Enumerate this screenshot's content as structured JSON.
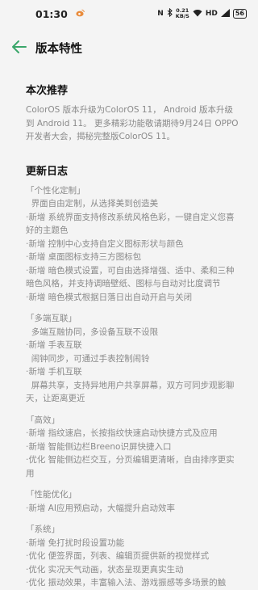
{
  "status_bar": {
    "time": "01:30",
    "app_icon": "weibo-icon",
    "nfc": "N",
    "bluetooth_icon": "bluetooth-icon",
    "net_speed": "0.21",
    "net_unit": "KB/S",
    "signal_label": "HD",
    "battery": "56"
  },
  "header": {
    "back_icon": "back-arrow-icon",
    "title": "版本特性",
    "accent_color": "#3aa66a"
  },
  "recommend": {
    "title": "本次推荐",
    "text": "ColorOS 版本升级为ColorOS 11， Android 版本升级到 Android 11。 更多精彩功能敬请期待9月24日 OPPO 开发者大会，揭秘完整版ColorOS 11。"
  },
  "changelog": {
    "title": "更新日志",
    "lines": [
      "「个性化定制」",
      "  界面自由定制，从选择美到创造美",
      "·新增 系统界面支持修改系统风格色彩，一键自定义您喜好的主题色",
      "·新增 控制中心支持自定义图标形状与颜色",
      "·新增 桌面图标支持三方图标包",
      "·新增 暗色模式设置，可自由选择增强、适中、柔和三种暗色风格，并支持调暗壁纸、图标与自动对比度调节",
      "·新增 暗色模式根据日落日出自动开启与关闭",
      "",
      "「多端互联」",
      "  多端互融协同，多设备互联不设限",
      "·新增 手表互联",
      "  闹钟同步，可通过手表控制闹铃",
      "·新增 手机互联",
      "  屏幕共享，支持异地用户共享屏幕，双方可同步观影聊天，让距离更近",
      "",
      "「高效」",
      "·新增 指纹速启，长按指纹快速启动快捷方式及应用",
      "·新增 智能侧边栏Breeno识屏快捷入口",
      "·优化 智能侧边栏交互，分页编辑更清晰，自由排序更实用",
      "",
      "「性能优化」",
      "·新增 AI应用预启动，大幅提升启动效率",
      "",
      "「系统」",
      "·新增 免打扰时段设置功能",
      "·优化 便签界面，列表、编辑页提供新的视觉样式",
      "·优化 实况天气动画，状态呈现更真实生动",
      "·优化 振动效果，丰富输入法、游戏振感等多场景的触"
    ]
  }
}
